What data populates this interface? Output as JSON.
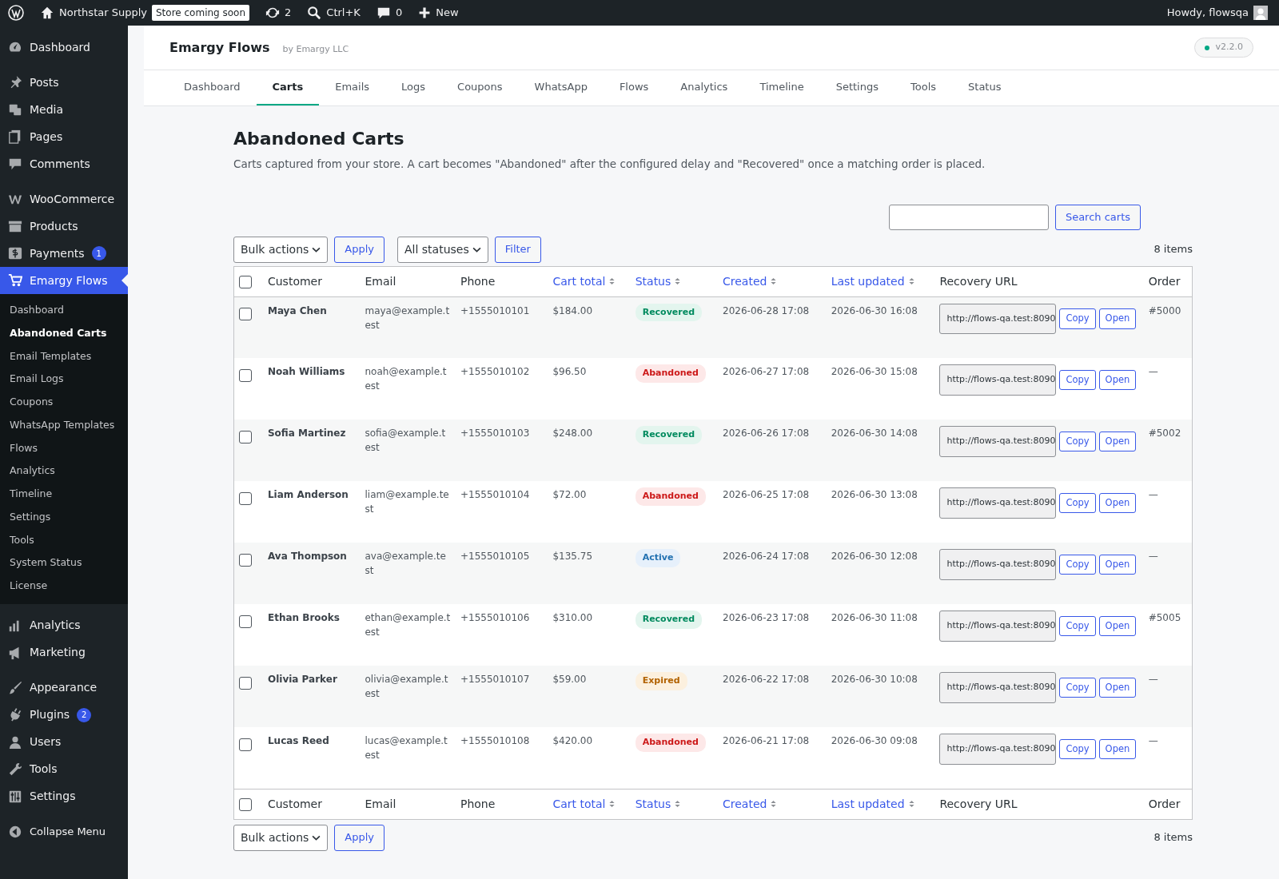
{
  "admin_bar": {
    "site": "Northstar Supply",
    "badge": "Store coming soon",
    "updates": "2",
    "search": "Ctrl+K",
    "comments": "0",
    "new": "New",
    "greeting": "Howdy, flowsqa"
  },
  "sidebar": {
    "groups": [
      [
        {
          "label": "Dashboard",
          "selected": false
        }
      ],
      [
        {
          "label": "Posts",
          "selected": false
        },
        {
          "label": "Media",
          "selected": false
        },
        {
          "label": "Pages",
          "selected": false
        },
        {
          "label": "Comments",
          "selected": false
        }
      ],
      [
        {
          "label": "WooCommerce",
          "selected": false
        },
        {
          "label": "Products",
          "selected": false
        },
        {
          "label": "Payments",
          "count": "1",
          "selected": false
        },
        {
          "label": "Emargy Flows",
          "selected": true
        }
      ],
      [
        {
          "label": "Analytics",
          "selected": false
        },
        {
          "label": "Marketing",
          "selected": false
        }
      ],
      [
        {
          "label": "Appearance",
          "selected": false
        },
        {
          "label": "Plugins",
          "count": "2",
          "selected": false
        },
        {
          "label": "Users",
          "selected": false
        },
        {
          "label": "Tools",
          "selected": false
        },
        {
          "label": "Settings",
          "selected": false
        }
      ]
    ],
    "submenu": [
      {
        "label": "Dashboard",
        "selected": false
      },
      {
        "label": "Abandoned Carts",
        "selected": true
      },
      {
        "label": "Email Templates",
        "selected": false
      },
      {
        "label": "Email Logs",
        "selected": false
      },
      {
        "label": "Coupons",
        "selected": false
      },
      {
        "label": "WhatsApp Templates",
        "selected": false
      },
      {
        "label": "Flows",
        "selected": false
      },
      {
        "label": "Analytics",
        "selected": false
      },
      {
        "label": "Timeline",
        "selected": false
      },
      {
        "label": "Settings",
        "selected": false
      },
      {
        "label": "Tools",
        "selected": false
      },
      {
        "label": "System Status",
        "selected": false
      },
      {
        "label": "License",
        "selected": false
      }
    ],
    "collapse": "Collapse Menu"
  },
  "plugin_header": {
    "title": "Emargy Flows",
    "byline": "by Emargy LLC",
    "version": "v2.2.0"
  },
  "tabs": [
    {
      "label": "Dashboard",
      "selected": false
    },
    {
      "label": "Carts",
      "selected": true
    },
    {
      "label": "Emails",
      "selected": false
    },
    {
      "label": "Logs",
      "selected": false
    },
    {
      "label": "Coupons",
      "selected": false
    },
    {
      "label": "WhatsApp",
      "selected": false
    },
    {
      "label": "Flows",
      "selected": false
    },
    {
      "label": "Analytics",
      "selected": false
    },
    {
      "label": "Timeline",
      "selected": false
    },
    {
      "label": "Settings",
      "selected": false
    },
    {
      "label": "Tools",
      "selected": false
    },
    {
      "label": "Status",
      "selected": false
    }
  ],
  "page": {
    "title": "Abandoned Carts",
    "description": "Carts captured from your store. A cart becomes \"Abandoned\" after the configured delay and \"Recovered\" once a matching order is placed.",
    "search_button": "Search carts",
    "bulk_actions": "Bulk actions",
    "apply": "Apply",
    "status_filter": "All statuses",
    "filter": "Filter",
    "items_top": "8 items",
    "items_bottom": "8 items",
    "bulk_actions_bottom": "Bulk actions",
    "apply_bottom": "Apply"
  },
  "table": {
    "header_checked": false,
    "footer_checked": false,
    "columns": [
      {
        "label": "Customer",
        "sortable": false
      },
      {
        "label": "Email",
        "sortable": false
      },
      {
        "label": "Phone",
        "sortable": false
      },
      {
        "label": "Cart total",
        "sortable": true
      },
      {
        "label": "Status",
        "sortable": true
      },
      {
        "label": "Created",
        "sortable": true
      },
      {
        "label": "Last updated",
        "sortable": true
      },
      {
        "label": "Recovery URL",
        "sortable": false
      },
      {
        "label": "Order",
        "sortable": false
      }
    ],
    "footer_columns": [
      {
        "label": "Customer",
        "sortable": false
      },
      {
        "label": "Email",
        "sortable": false
      },
      {
        "label": "Phone",
        "sortable": false
      },
      {
        "label": "Cart total",
        "sortable": true
      },
      {
        "label": "Status",
        "sortable": true
      },
      {
        "label": "Created",
        "sortable": true
      },
      {
        "label": "Last updated",
        "sortable": true
      },
      {
        "label": "Recovery URL",
        "sortable": false
      },
      {
        "label": "Order",
        "sortable": false
      }
    ],
    "rows": [
      {
        "checked": false,
        "customer": "Maya Chen",
        "email": "maya@example.test",
        "phone": "+1555010101",
        "total": "$184.00",
        "status": {
          "label": "Recovered",
          "kind": "recovered"
        },
        "created": "2026-06-28 17:08",
        "updated": "2026-06-30 16:08",
        "url": "http://flows-qa.test:8090",
        "copy": "Copy",
        "open": "Open",
        "order": "#5000"
      },
      {
        "checked": false,
        "customer": "Noah Williams",
        "email": "noah@example.test",
        "phone": "+1555010102",
        "total": "$96.50",
        "status": {
          "label": "Abandoned",
          "kind": "abandoned"
        },
        "created": "2026-06-27 17:08",
        "updated": "2026-06-30 15:08",
        "url": "http://flows-qa.test:8090",
        "copy": "Copy",
        "open": "Open",
        "order": "—"
      },
      {
        "checked": false,
        "customer": "Sofia Martinez",
        "email": "sofia@example.test",
        "phone": "+1555010103",
        "total": "$248.00",
        "status": {
          "label": "Recovered",
          "kind": "recovered"
        },
        "created": "2026-06-26 17:08",
        "updated": "2026-06-30 14:08",
        "url": "http://flows-qa.test:8090",
        "copy": "Copy",
        "open": "Open",
        "order": "#5002"
      },
      {
        "checked": false,
        "customer": "Liam Anderson",
        "email": "liam@example.test",
        "phone": "+1555010104",
        "total": "$72.00",
        "status": {
          "label": "Abandoned",
          "kind": "abandoned"
        },
        "created": "2026-06-25 17:08",
        "updated": "2026-06-30 13:08",
        "url": "http://flows-qa.test:8090",
        "copy": "Copy",
        "open": "Open",
        "order": "—"
      },
      {
        "checked": false,
        "customer": "Ava Thompson",
        "email": "ava@example.test",
        "phone": "+1555010105",
        "total": "$135.75",
        "status": {
          "label": "Active",
          "kind": "active"
        },
        "created": "2026-06-24 17:08",
        "updated": "2026-06-30 12:08",
        "url": "http://flows-qa.test:8090",
        "copy": "Copy",
        "open": "Open",
        "order": "—"
      },
      {
        "checked": false,
        "customer": "Ethan Brooks",
        "email": "ethan@example.test",
        "phone": "+1555010106",
        "total": "$310.00",
        "status": {
          "label": "Recovered",
          "kind": "recovered"
        },
        "created": "2026-06-23 17:08",
        "updated": "2026-06-30 11:08",
        "url": "http://flows-qa.test:8090",
        "copy": "Copy",
        "open": "Open",
        "order": "#5005"
      },
      {
        "checked": false,
        "customer": "Olivia Parker",
        "email": "olivia@example.test",
        "phone": "+1555010107",
        "total": "$59.00",
        "status": {
          "label": "Expired",
          "kind": "expired"
        },
        "created": "2026-06-22 17:08",
        "updated": "2026-06-30 10:08",
        "url": "http://flows-qa.test:8090",
        "copy": "Copy",
        "open": "Open",
        "order": "—"
      },
      {
        "checked": false,
        "customer": "Lucas Reed",
        "email": "lucas@example.test",
        "phone": "+1555010108",
        "total": "$420.00",
        "status": {
          "label": "Abandoned",
          "kind": "abandoned"
        },
        "created": "2026-06-21 17:08",
        "updated": "2026-06-30 09:08",
        "url": "http://flows-qa.test:8090",
        "copy": "Copy",
        "open": "Open",
        "order": "—"
      }
    ]
  }
}
